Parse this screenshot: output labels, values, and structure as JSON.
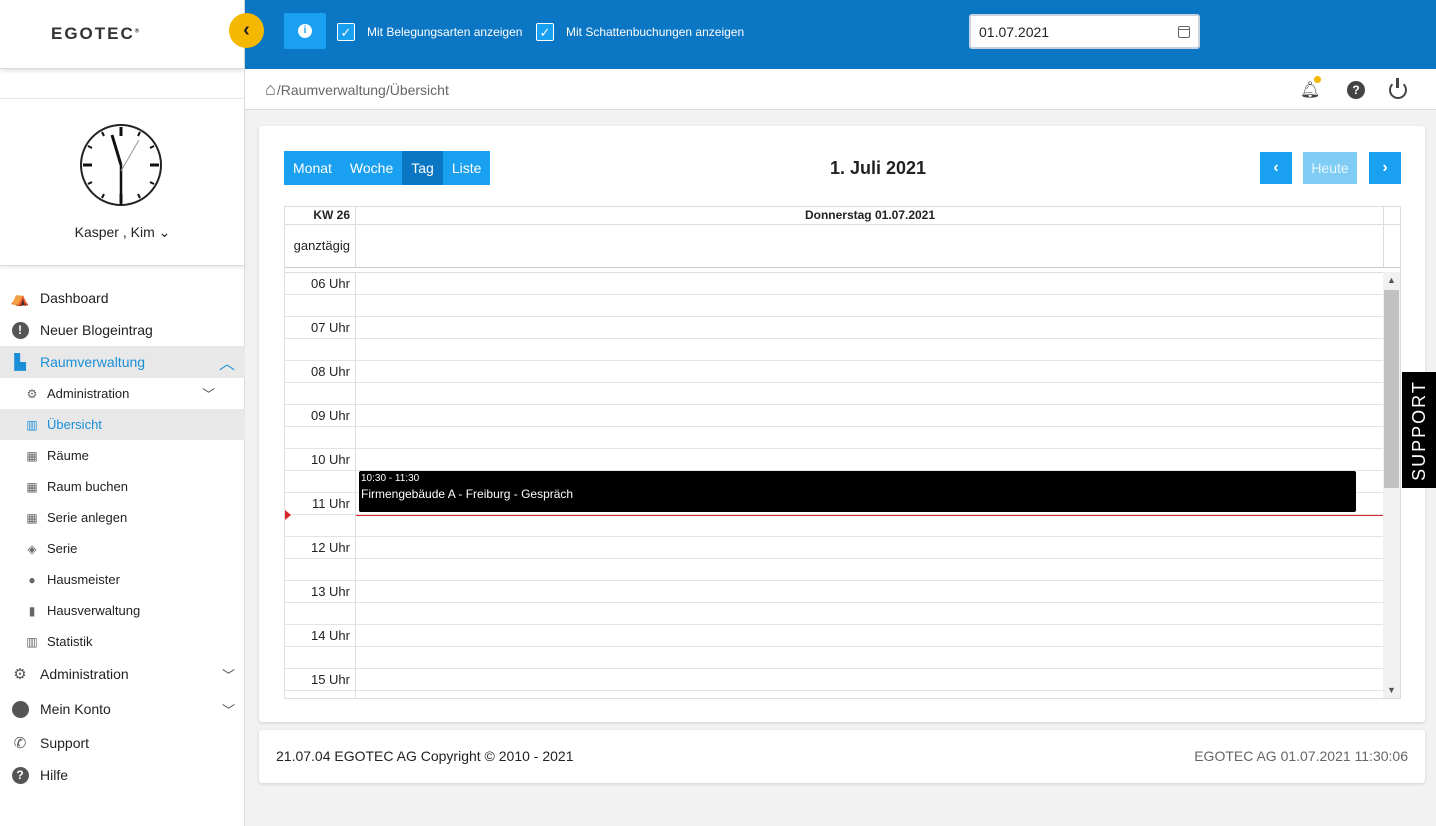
{
  "app": {
    "logo": "EGOTEC"
  },
  "topbar": {
    "show_types_label": "Mit Belegungsarten anzeigen",
    "show_shadow_label": "Mit Schattenbuchungen anzeigen",
    "date_value": "01.07.2021",
    "accent_color": "#0a76c4"
  },
  "user": {
    "name": "Kasper , Kim"
  },
  "nav": {
    "dashboard": "Dashboard",
    "blog": "Neuer Blogeintrag",
    "rooms": "Raumverwaltung",
    "sub": {
      "administration": "Administration",
      "overview": "Übersicht",
      "rooms": "Räume",
      "book": "Raum buchen",
      "series_create": "Serie anlegen",
      "series": "Serie",
      "caretaker": "Hausmeister",
      "property": "Hausverwaltung",
      "stats": "Statistik"
    },
    "administration": "Administration",
    "account": "Mein Konto",
    "support": "Support",
    "help": "Hilfe"
  },
  "breadcrumb": "/Raumverwaltung/Übersicht",
  "calendar": {
    "views": [
      "Monat",
      "Woche",
      "Tag",
      "Liste"
    ],
    "selected_view": "Tag",
    "title": "1. Juli 2021",
    "today_label": "Heute",
    "week_label": "KW 26",
    "day_header": "Donnerstag 01.07.2021",
    "allday_label": "ganztägig",
    "hours": [
      "06 Uhr",
      "07 Uhr",
      "08 Uhr",
      "09 Uhr",
      "10 Uhr",
      "11 Uhr",
      "12 Uhr",
      "13 Uhr",
      "14 Uhr",
      "15 Uhr"
    ],
    "event": {
      "time": "10:30 - 11:30",
      "title": "Firmengebäude A - Freiburg - Gespräch"
    }
  },
  "support_tab": "SUPPORT",
  "footer": {
    "left": "21.07.04 EGOTEC AG Copyright © 2010 - 2021",
    "right": "EGOTEC AG  01.07.2021 11:30:06"
  }
}
